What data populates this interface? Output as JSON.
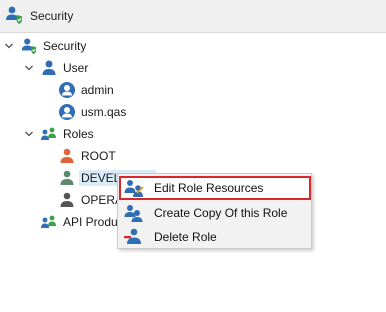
{
  "titlebar": {
    "title": "Security",
    "icon": "security-shield-user-icon"
  },
  "tree": {
    "root": {
      "label": "Security",
      "expanded": true,
      "icon": "security-shield-user-icon"
    },
    "user": {
      "label": "User",
      "expanded": true,
      "icon": "user-icon"
    },
    "users": [
      {
        "label": "admin",
        "icon": "user-circle-icon"
      },
      {
        "label": "usm.qas",
        "icon": "user-circle-icon"
      }
    ],
    "roles": {
      "label": "Roles",
      "expanded": true,
      "icon": "group-icon"
    },
    "role_items": [
      {
        "label": "ROOT",
        "icon": "role-person-icon",
        "color": "#e0643a"
      },
      {
        "label": "DEVELOPER",
        "icon": "role-person-icon",
        "color": "#5a8a6e",
        "selected": true
      },
      {
        "label": "OPERATOR",
        "icon": "role-person-icon",
        "color": "#555555"
      }
    ],
    "api_products": {
      "label": "API Products",
      "icon": "group-icon"
    }
  },
  "context_menu": {
    "items": [
      {
        "label": "Edit Role Resources",
        "icon": "edit-role-resources-icon",
        "highlighted": true
      },
      {
        "label": "Create Copy Of this Role",
        "icon": "copy-role-icon"
      },
      {
        "label": "Delete Role",
        "icon": "delete-role-icon"
      }
    ]
  },
  "colors": {
    "accent_blue": "#2f6db5",
    "highlight_red": "#d9262b",
    "selection": "#d9ebf9"
  }
}
